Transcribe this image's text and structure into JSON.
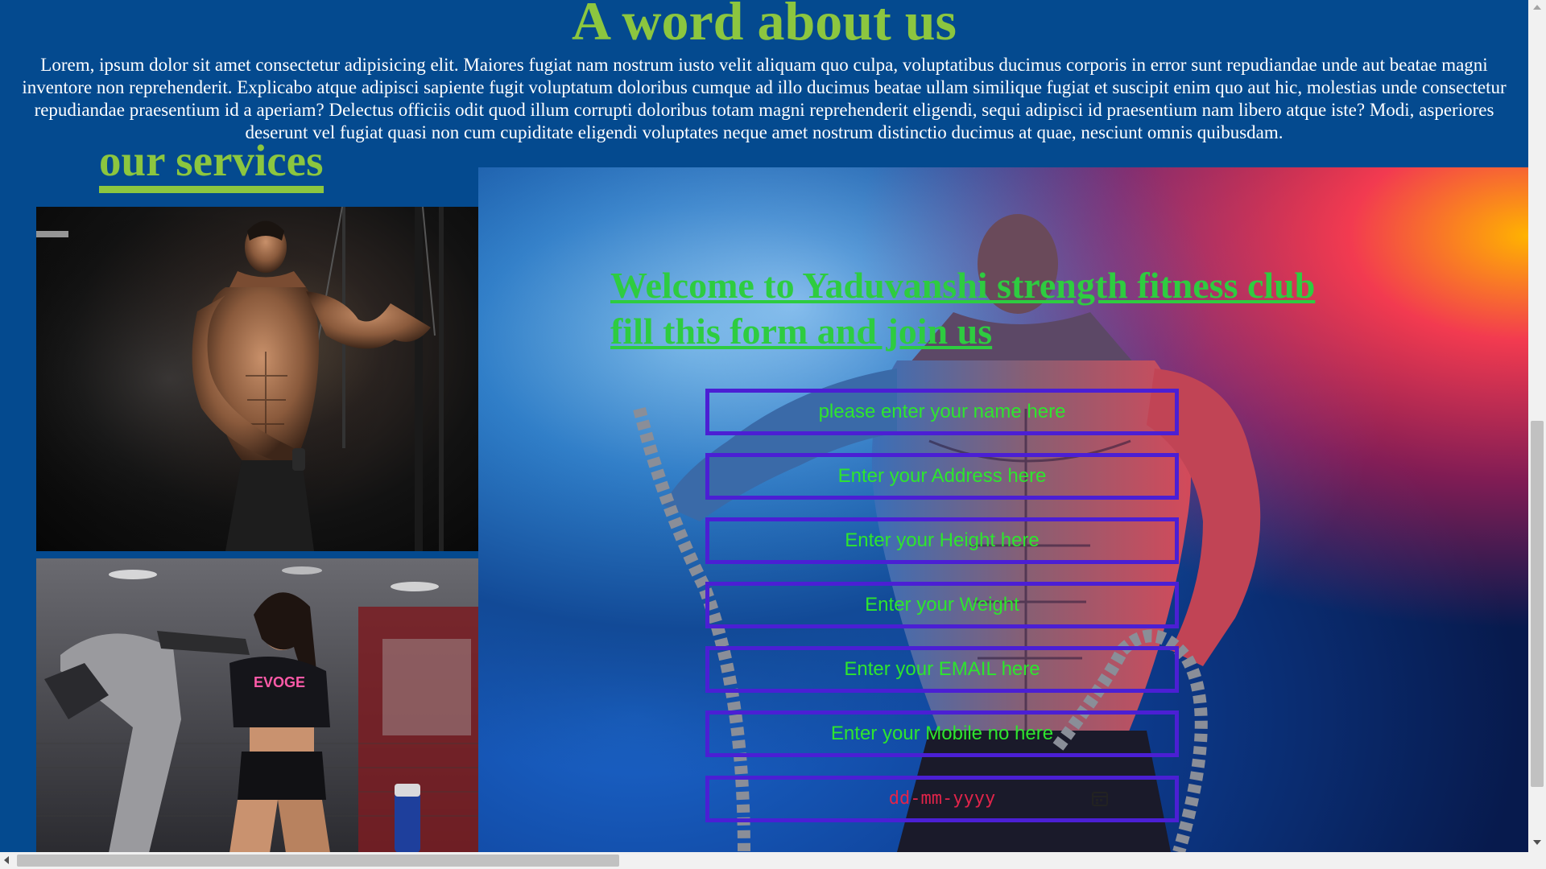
{
  "about": {
    "title": "A word about us",
    "text": "Lorem, ipsum dolor sit amet consectetur adipisicing elit. Maiores fugiat nam nostrum iusto velit aliquam quo culpa, voluptatibus ducimus corporis in error sunt repudiandae unde aut beatae magni inventore non reprehenderit. Explicabo atque adipisci sapiente fugit voluptatum doloribus cumque ad illo ducimus beatae ullam similique fugiat et suscipit enim quo aut hic, molestias unde consectetur repudiandae praesentium id a aperiam? Delectus officiis odit quod illum corrupti doloribus totam magni reprehenderit eligendi, sequi adipisci id praesentium nam libero atque iste? Modi, asperiores deserunt vel fugiat quasi non cum cupiditate eligendi voluptates neque amet nostrum distinctio ducimus at quae, nesciunt omnis quibusdam."
  },
  "services": {
    "title": "our services"
  },
  "form": {
    "heading_line1": "Welcome to Yaduvanshi strength fitness club",
    "heading_line2": "fill this form and join us",
    "name_placeholder": "please enter your name here",
    "address_placeholder": "Enter your Address here",
    "height_placeholder": "Enter your Height here",
    "weight_placeholder": "Enter your Weight",
    "email_placeholder": "Enter your EMAIL here",
    "mobile_placeholder": "Enter your Mobile no here",
    "date_placeholder": "dd-mm-yyyy"
  },
  "colors": {
    "background": "#044a8f",
    "heading": "#8cc63f",
    "form_heading": "#2ecc40",
    "field_border": "#4b1fd4",
    "field_text": "#2ee52e",
    "date_text": "#e0244a"
  },
  "icons": {
    "date": "calendar-icon"
  }
}
